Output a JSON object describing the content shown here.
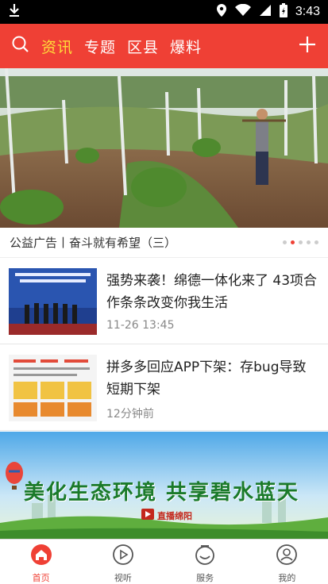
{
  "status_bar": {
    "time": "3:43",
    "icons": [
      "download-icon",
      "location-icon",
      "wifi-icon",
      "signal-icon",
      "battery-icon"
    ]
  },
  "header": {
    "tabs": [
      {
        "label": "资讯",
        "active": true
      },
      {
        "label": "专题",
        "active": false
      },
      {
        "label": "区县",
        "active": false
      },
      {
        "label": "爆料",
        "active": false
      }
    ],
    "icons": [
      "search-icon",
      "plus-icon"
    ],
    "accent": "#ef4035",
    "active_tab_color": "#ffdc3a"
  },
  "banner": {
    "caption": "公益广告丨奋斗就有希望（三）",
    "slide_count": 5,
    "active_slide": 2
  },
  "news": [
    {
      "title": "强势来袭！绵德一体化来了 43项合作条条改变你我生活",
      "time": "11-26 13:45"
    },
    {
      "title": "拼多多回应APP下架：存bug导致短期下架",
      "time": "12分钟前"
    }
  ],
  "ad": {
    "slogan": "美化生态环境 共享碧水蓝天",
    "logo_text": "直播绵阳"
  },
  "bottom_nav": [
    {
      "label": "首页",
      "icon": "home-icon",
      "active": true
    },
    {
      "label": "视听",
      "icon": "play-icon",
      "active": false
    },
    {
      "label": "服务",
      "icon": "service-icon",
      "active": false
    },
    {
      "label": "我的",
      "icon": "profile-icon",
      "active": false
    }
  ]
}
